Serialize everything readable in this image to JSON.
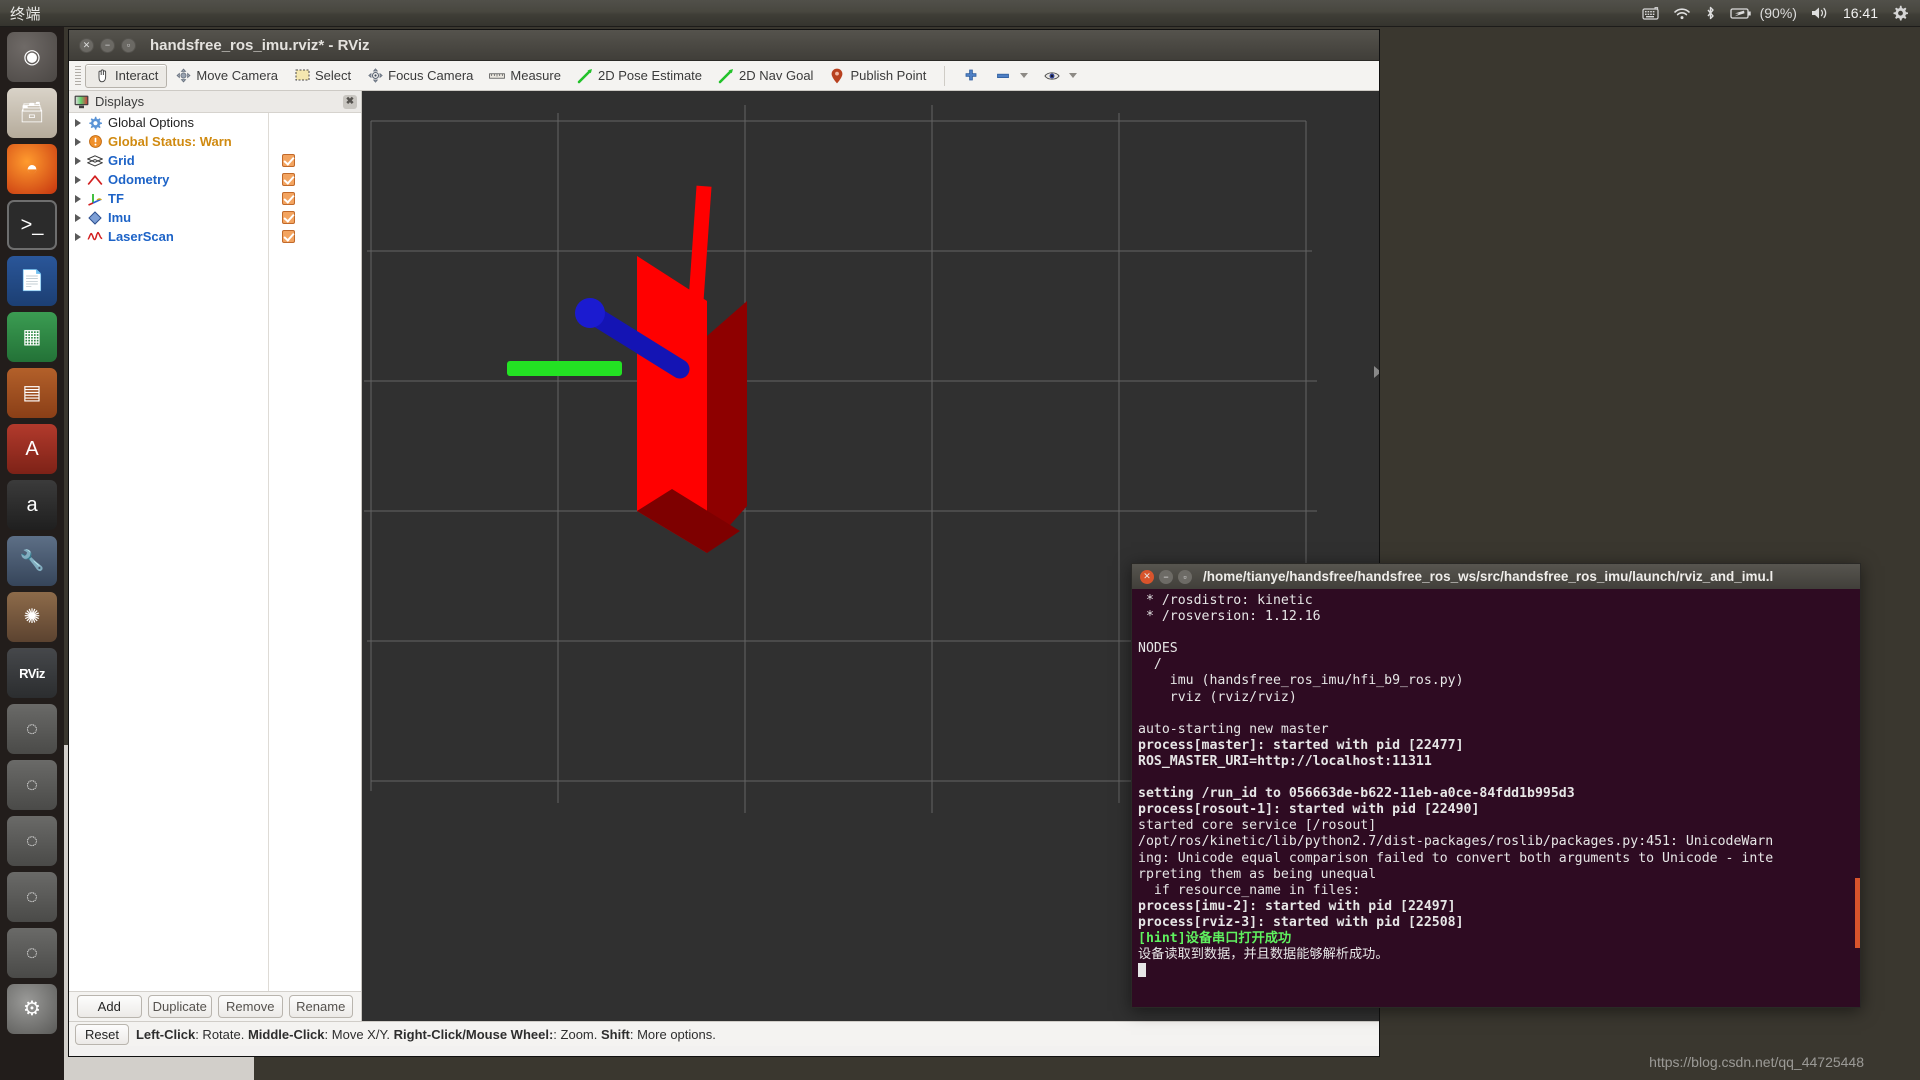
{
  "top_panel": {
    "menu_label": "终端",
    "tray": {
      "keyboard_icon": "keyboard-icon",
      "wifi_icon": "wifi-icon",
      "bluetooth_icon": "bluetooth-icon",
      "battery_icon": "battery-icon",
      "battery_text": "(90%)",
      "volume_icon": "volume-icon",
      "clock": "16:41",
      "gear_icon": "gear-icon"
    }
  },
  "launcher": {
    "items": [
      {
        "name": "ubuntu-dash",
        "glyph": "◉",
        "cls": "ubuntu"
      },
      {
        "name": "files",
        "glyph": "🗃",
        "cls": "files"
      },
      {
        "name": "firefox",
        "glyph": "◓",
        "cls": "firefox"
      },
      {
        "name": "terminal",
        "glyph": ">_",
        "cls": "term"
      },
      {
        "name": "libreoffice-writer",
        "glyph": "📄",
        "cls": "writer"
      },
      {
        "name": "libreoffice-calc",
        "glyph": "▦",
        "cls": "calc"
      },
      {
        "name": "libreoffice-impress",
        "glyph": "▤",
        "cls": "impress"
      },
      {
        "name": "font-manager",
        "glyph": "A",
        "cls": "fonts"
      },
      {
        "name": "amazon",
        "glyph": "a",
        "cls": "amazon"
      },
      {
        "name": "software-tools",
        "glyph": "🔧",
        "cls": "tools"
      },
      {
        "name": "gimp",
        "glyph": "✺",
        "cls": "gimp"
      },
      {
        "name": "rviz",
        "glyph": "RViz",
        "cls": "rviz"
      },
      {
        "name": "app-13",
        "glyph": "◌",
        "cls": "gray"
      },
      {
        "name": "app-14",
        "glyph": "◌",
        "cls": "gray"
      },
      {
        "name": "app-15",
        "glyph": "◌",
        "cls": "gray"
      },
      {
        "name": "app-16",
        "glyph": "◌",
        "cls": "gray"
      },
      {
        "name": "app-17",
        "glyph": "◌",
        "cls": "gray"
      },
      {
        "name": "system-settings",
        "glyph": "⚙",
        "cls": "settings"
      }
    ]
  },
  "rviz": {
    "title": "handsfree_ros_imu.rviz* - RViz",
    "toolbar": [
      {
        "label": "Interact",
        "icon": "hand-cursor-icon",
        "active": true
      },
      {
        "label": "Move Camera",
        "icon": "move-camera-icon",
        "active": false
      },
      {
        "label": "Select",
        "icon": "select-rect-icon",
        "active": false
      },
      {
        "label": "Focus Camera",
        "icon": "focus-camera-icon",
        "active": false
      },
      {
        "label": "Measure",
        "icon": "ruler-icon",
        "active": false
      },
      {
        "label": "2D Pose Estimate",
        "icon": "pose-arrow-icon",
        "active": false
      },
      {
        "label": "2D Nav Goal",
        "icon": "nav-goal-arrow-icon",
        "active": false
      },
      {
        "label": "Publish Point",
        "icon": "map-pin-icon",
        "active": false
      }
    ],
    "toolbar_right": {
      "plus_icon": "plus-icon",
      "minus_icon": "minus-icon",
      "eye_icon": "eye-icon"
    },
    "displays": {
      "header": "Displays",
      "close_icon": "close-icon",
      "items": [
        {
          "label": "Global Options",
          "icon": "gear-icon",
          "style": "plain",
          "checkbox": false
        },
        {
          "label": "Global Status: Warn",
          "icon": "warning-icon",
          "style": "warn",
          "checkbox": false
        },
        {
          "label": "Grid",
          "icon": "grid-icon",
          "style": "item",
          "checkbox": true
        },
        {
          "label": "Odometry",
          "icon": "odometry-icon",
          "style": "item",
          "checkbox": true
        },
        {
          "label": "TF",
          "icon": "tf-axes-icon",
          "style": "item",
          "checkbox": true
        },
        {
          "label": "Imu",
          "icon": "imu-icon",
          "style": "item",
          "checkbox": true
        },
        {
          "label": "LaserScan",
          "icon": "laserscan-icon",
          "style": "item",
          "checkbox": true
        }
      ],
      "buttons": [
        {
          "label": "Add",
          "enabled": true
        },
        {
          "label": "Duplicate",
          "enabled": false
        },
        {
          "label": "Remove",
          "enabled": false
        },
        {
          "label": "Rename",
          "enabled": false
        }
      ]
    },
    "status": {
      "reset_label": "Reset",
      "hint_parts": [
        {
          "t": "Left-Click",
          "b": true
        },
        {
          "t": ": Rotate.  ",
          "b": false
        },
        {
          "t": "Middle-Click",
          "b": true
        },
        {
          "t": ": Move X/Y.  ",
          "b": false
        },
        {
          "t": "Right-Click/Mouse Wheel:",
          "b": true
        },
        {
          "t": ": Zoom.  ",
          "b": false
        },
        {
          "t": "Shift",
          "b": true
        },
        {
          "t": ": More options.",
          "b": false
        }
      ]
    },
    "scene": {
      "background_color": "#303030",
      "grid_color": "#6a6a6a",
      "box_color": "#ff0000",
      "imu_arrow_color": "#00d000",
      "odom_arrow_color": "#0b0bbb"
    }
  },
  "terminal": {
    "title": "/home/tianye/handsfree/handsfree_ros_ws/src/handsfree_ros_imu/launch/rviz_and_imu.l",
    "lines": [
      {
        "t": " * /rosdistro: kinetic",
        "s": "n"
      },
      {
        "t": " * /rosversion: 1.12.16",
        "s": "n"
      },
      {
        "t": "",
        "s": "n"
      },
      {
        "t": "NODES",
        "s": "n"
      },
      {
        "t": "  /",
        "s": "n"
      },
      {
        "t": "    imu (handsfree_ros_imu/hfi_b9_ros.py)",
        "s": "n"
      },
      {
        "t": "    rviz (rviz/rviz)",
        "s": "n"
      },
      {
        "t": "",
        "s": "n"
      },
      {
        "t": "auto-starting new master",
        "s": "n"
      },
      {
        "t": "process[master]: started with pid [22477]",
        "s": "b"
      },
      {
        "t": "ROS_MASTER_URI=http://localhost:11311",
        "s": "b"
      },
      {
        "t": "",
        "s": "n"
      },
      {
        "t": "setting /run_id to 056663de-b622-11eb-a0ce-84fdd1b995d3",
        "s": "b"
      },
      {
        "t": "process[rosout-1]: started with pid [22490]",
        "s": "b"
      },
      {
        "t": "started core service [/rosout]",
        "s": "n"
      },
      {
        "t": "/opt/ros/kinetic/lib/python2.7/dist-packages/roslib/packages.py:451: UnicodeWarn",
        "s": "n"
      },
      {
        "t": "ing: Unicode equal comparison failed to convert both arguments to Unicode - inte",
        "s": "n"
      },
      {
        "t": "rpreting them as being unequal",
        "s": "n"
      },
      {
        "t": "  if resource_name in files:",
        "s": "n"
      },
      {
        "t": "process[imu-2]: started with pid [22497]",
        "s": "b"
      },
      {
        "t": "process[rviz-3]: started with pid [22508]",
        "s": "b"
      },
      {
        "t": "[hint]设备串口打开成功",
        "s": "g"
      },
      {
        "t": "设备读取到数据，并且数据能够解析成功。",
        "s": "n"
      }
    ]
  },
  "watermark": "https://blog.csdn.net/qq_44725448"
}
